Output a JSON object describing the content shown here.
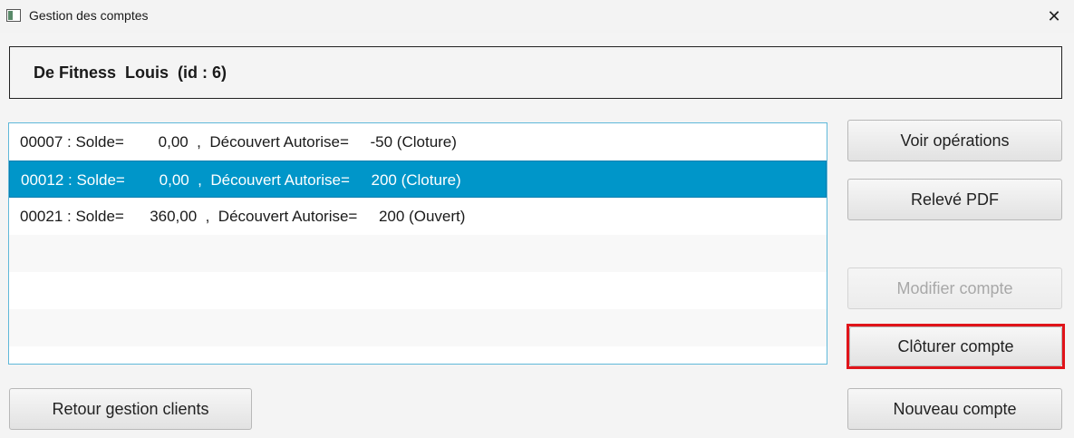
{
  "window": {
    "title": "Gestion des comptes",
    "close_glyph": "✕"
  },
  "header": {
    "client_label": "De Fitness  Louis  (id : 6)"
  },
  "accounts": [
    {
      "text": "00007 : Solde=        0,00  ,  Découvert Autorise=     -50 (Cloture)",
      "selected": false
    },
    {
      "text": "00012 : Solde=        0,00  ,  Découvert Autorise=     200 (Cloture)",
      "selected": true
    },
    {
      "text": "00021 : Solde=      360,00  ,  Découvert Autorise=     200 (Ouvert)",
      "selected": false
    }
  ],
  "buttons": {
    "voir_operations": "Voir opérations",
    "releve_pdf": "Relevé PDF",
    "modifier_compte": "Modifier compte",
    "cloturer_compte": "Clôturer compte",
    "nouveau_compte": "Nouveau compte",
    "retour": "Retour gestion clients"
  },
  "colors": {
    "selection": "#0096c9",
    "highlight": "#e0141a",
    "list_border": "#5fb8d9"
  }
}
